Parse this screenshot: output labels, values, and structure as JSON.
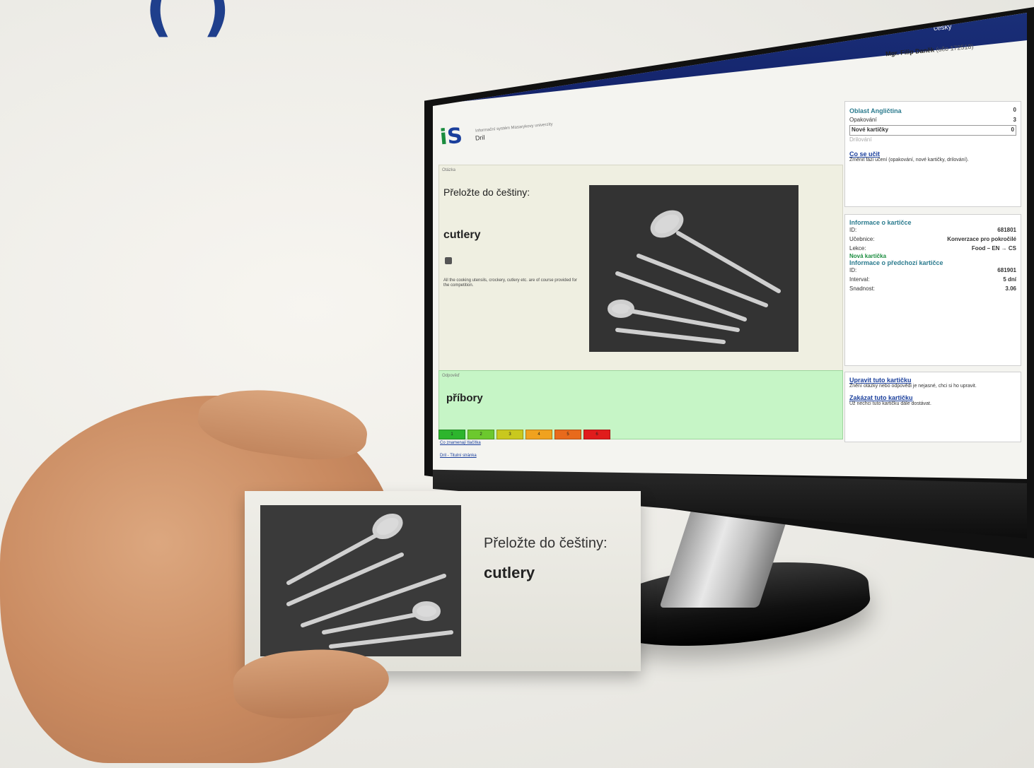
{
  "header": {
    "title_fragment": "(    )"
  },
  "screen": {
    "language": "česky",
    "user_name": "Mgr. Filip Daněk",
    "user_uco": "(učo 172518)",
    "app_subtitle": "Informační systém Masarykovy univerzity",
    "app_name": "Dril",
    "question": {
      "label": "Otázka",
      "prompt": "Přeložte do češtiny:",
      "word": "cutlery",
      "example": "All the cooking utensils, crockery, cutlery etc. are of course provided for the competition."
    },
    "answer": {
      "label": "Odpověď",
      "word": "příbory"
    },
    "ratings": [
      "1",
      "2",
      "3",
      "4",
      "5",
      "6"
    ],
    "rating_colors": [
      "#2db52d",
      "#6cc82e",
      "#c9c81e",
      "#f0a21f",
      "#e86a1c",
      "#e01c1c"
    ],
    "footer_links": [
      "Co znamenají tlačítka",
      "Dril - Titulní stránka"
    ],
    "sidebar": {
      "area_title": "Oblast Angličtina",
      "area_count": "0",
      "modes": [
        {
          "label": "Opakování",
          "count": "3"
        },
        {
          "label": "Nové kartičky",
          "count": "0"
        },
        {
          "label": "Drilování",
          "count": ""
        }
      ],
      "learn_link": "Co se učit",
      "learn_desc": "Změnit fázi učení (opakování, nové kartičky, drilování).",
      "card_info_title": "Informace o kartičce",
      "card_info": [
        {
          "label": "ID:",
          "value": "681801"
        },
        {
          "label": "Učebnice:",
          "value": "Konverzace pro pokročilé"
        },
        {
          "label": "Lekce:",
          "value": "Food – EN → CS"
        }
      ],
      "new_card": "Nová kartička",
      "prev_card_title": "Informace o předchozí kartičce",
      "prev_card_info": [
        {
          "label": "ID:",
          "value": "681901"
        },
        {
          "label": "Interval:",
          "value": "5 dní"
        },
        {
          "label": "Snadnost:",
          "value": "3.06"
        }
      ],
      "edit_link": "Upravit tuto kartičku",
      "edit_desc": "Znění otázky nebo odpovědi je nejasné, chci si ho upravit.",
      "disable_link": "Zakázat tuto kartičku",
      "disable_desc": "Už nechci tuto kartičku dále dostávat."
    }
  },
  "card": {
    "prompt": "Přeložte do češtiny:",
    "word": "cutlery"
  }
}
